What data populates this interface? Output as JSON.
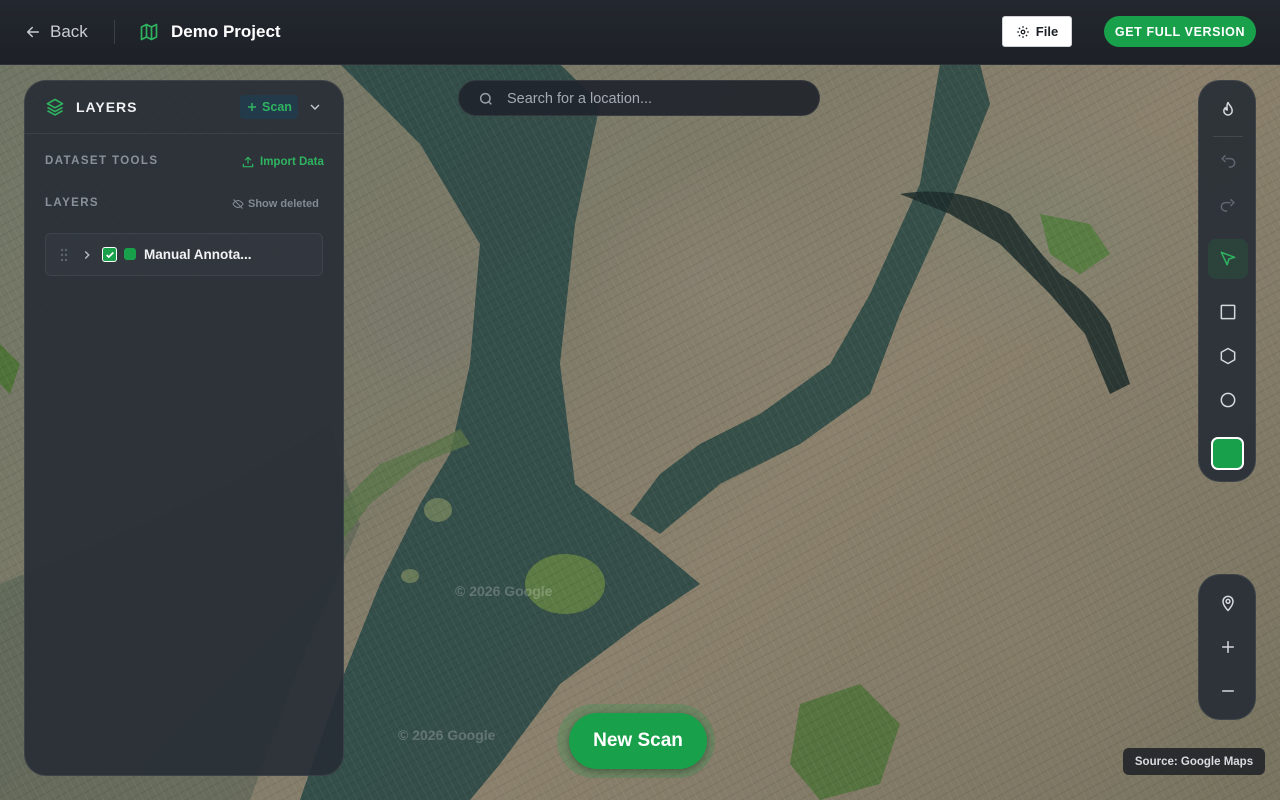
{
  "header": {
    "back_label": "Back",
    "project_title": "Demo Project",
    "file_label": "File",
    "full_version_label": "GET FULL VERSION"
  },
  "layers_panel": {
    "title": "LAYERS",
    "scan_label": "Scan",
    "dataset_tools_label": "DATASET TOOLS",
    "import_label": "Import Data",
    "layers_section_label": "LAYERS",
    "show_deleted_label": "Show deleted",
    "layers": [
      {
        "name": "Manual Annota...",
        "checked": true,
        "color": "#19a04b"
      }
    ]
  },
  "search": {
    "placeholder": "Search for a location..."
  },
  "toolbar": {
    "tools": [
      "fire-icon",
      "undo-icon",
      "redo-icon",
      "select-arrow-icon",
      "rectangle-icon",
      "hexagon-icon",
      "circle-icon"
    ],
    "active_tool": "select-arrow-icon",
    "color": "#19a04b"
  },
  "map_controls": [
    "location-pin-icon",
    "zoom-in-icon",
    "zoom-out-icon"
  ],
  "map": {
    "watermark": "© 2026 Google",
    "source_label": "Source: Google Maps"
  },
  "new_scan_label": "New Scan",
  "colors": {
    "accent": "#19a04b",
    "panel": "#282e36",
    "topbar": "#1f2329"
  }
}
